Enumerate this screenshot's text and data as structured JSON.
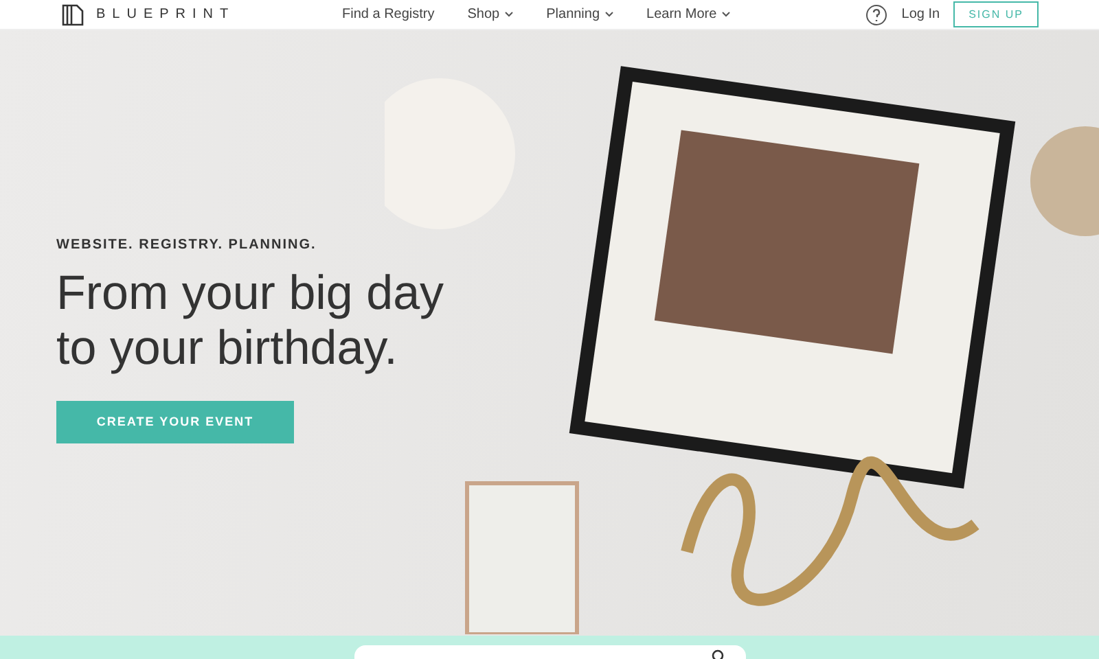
{
  "nav": {
    "logo": "BLUEPRINT",
    "links": [
      {
        "label": "Find a Registry",
        "dropdown": false
      },
      {
        "label": "Shop",
        "dropdown": true
      },
      {
        "label": "Planning",
        "dropdown": true
      },
      {
        "label": "Learn More",
        "dropdown": true
      }
    ],
    "login": "Log In",
    "signup": "SIGN UP"
  },
  "hero": {
    "eyebrow": "WEBSITE. REGISTRY. PLANNING.",
    "headline": [
      "From your big day",
      "to your birthday."
    ],
    "cta": "CREATE YOUR EVENT"
  }
}
